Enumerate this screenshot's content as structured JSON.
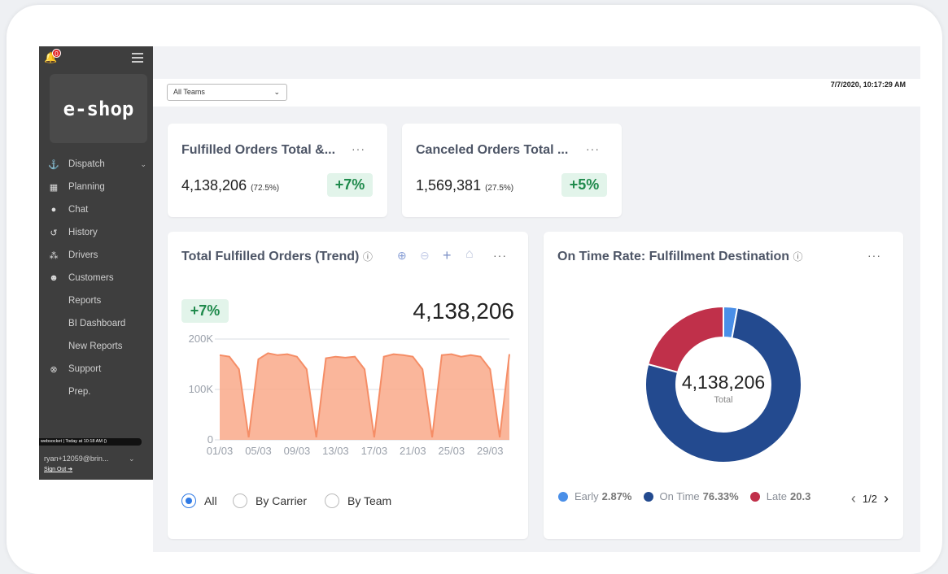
{
  "sidebar": {
    "notifications_badge": "0",
    "logo": "e-shop",
    "items": [
      {
        "label": "Dispatch",
        "icon": "anchor-icon",
        "glyph": "⚓",
        "expandable": true
      },
      {
        "label": "Planning",
        "icon": "calendar-icon",
        "glyph": "▦"
      },
      {
        "label": "Chat",
        "icon": "chat-icon",
        "glyph": "●"
      },
      {
        "label": "History",
        "icon": "history-icon",
        "glyph": "↺"
      },
      {
        "label": "Drivers",
        "icon": "sitemap-icon",
        "glyph": "⁂"
      },
      {
        "label": "Customers",
        "icon": "users-icon",
        "glyph": "☻"
      },
      {
        "label": "Reports",
        "icon": "",
        "glyph": ""
      },
      {
        "label": "BI Dashboard",
        "icon": "",
        "glyph": ""
      },
      {
        "label": "New Reports",
        "icon": "",
        "glyph": ""
      },
      {
        "label": "Support",
        "icon": "support-icon",
        "glyph": "⊗"
      },
      {
        "label": "Prep.",
        "icon": "",
        "glyph": ""
      }
    ],
    "websocket_status": "websocket | Today at 10:18 AM ()",
    "user": "ryan+12059@brin...",
    "sign_out": "Sign Out"
  },
  "topbar": {
    "team_select_value": "All Teams",
    "datetime": "7/7/2020, 10:17:29 AM"
  },
  "kpi_cards": [
    {
      "title": "Fulfilled Orders Total &...",
      "value": "4,138,206",
      "pct": "(72.5%)",
      "change": "+7%"
    },
    {
      "title": "Canceled Orders Total ...",
      "value": "1,569,381",
      "pct": "(27.5%)",
      "change": "+5%"
    }
  ],
  "trend_card": {
    "title": "Total Fulfilled Orders (Trend)",
    "change": "+7%",
    "total": "4,138,206",
    "filters": [
      "All",
      "By Carrier",
      "By Team"
    ],
    "selected_filter": "All"
  },
  "donut_card": {
    "title": "On Time Rate: Fulfillment Destination",
    "center_value": "4,138,206",
    "center_label": "Total",
    "legend": [
      {
        "label": "Early",
        "value": "2.87%",
        "color": "#4a8fe8"
      },
      {
        "label": "On Time",
        "value": "76.33%",
        "color": "#234a8f"
      },
      {
        "label": "Late",
        "value": "20.3",
        "color": "#c0304a"
      }
    ],
    "page": "1/2"
  },
  "chart_data": [
    {
      "type": "area",
      "x": [
        "01/03",
        "02/03",
        "03/03",
        "04/03",
        "05/03",
        "06/03",
        "07/03",
        "08/03",
        "09/03",
        "10/03",
        "11/03",
        "12/03",
        "13/03",
        "14/03",
        "15/03",
        "16/03",
        "17/03",
        "18/03",
        "19/03",
        "20/03",
        "21/03",
        "22/03",
        "23/03",
        "24/03",
        "25/03",
        "26/03",
        "27/03",
        "28/03",
        "29/03",
        "30/03",
        "31/03"
      ],
      "xticks": [
        "01/03",
        "05/03",
        "09/03",
        "13/03",
        "17/03",
        "21/03",
        "25/03",
        "29/03"
      ],
      "values": [
        168000,
        165000,
        140000,
        5000,
        160000,
        172000,
        168000,
        170000,
        165000,
        140000,
        5000,
        162000,
        165000,
        163000,
        165000,
        140000,
        5000,
        165000,
        170000,
        168000,
        165000,
        140000,
        5000,
        168000,
        170000,
        165000,
        168000,
        165000,
        140000,
        5000,
        170000
      ],
      "yticks": [
        "0",
        "100K",
        "200K"
      ],
      "ylim": [
        0,
        200000
      ],
      "color": "#f58d66"
    },
    {
      "type": "pie",
      "categories": [
        "Early",
        "On Time",
        "Late"
      ],
      "values": [
        2.87,
        76.33,
        20.8
      ],
      "colors": [
        "#4a8fe8",
        "#234a8f",
        "#c0304a"
      ]
    }
  ]
}
